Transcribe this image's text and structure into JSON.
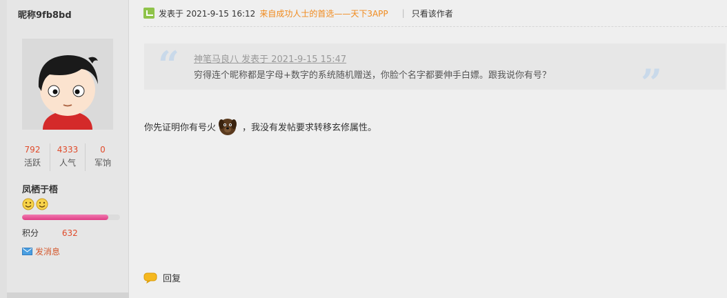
{
  "author": {
    "username": "昵称9fb8bd",
    "stats": [
      {
        "value": "792",
        "label": "活跃"
      },
      {
        "value": "4333",
        "label": "人气"
      },
      {
        "value": "0",
        "label": "军饷"
      }
    ],
    "group": "凤栖于梧",
    "points_label": "积分",
    "points_value": "632",
    "level_progress_percent": 88,
    "send_message": "发消息"
  },
  "post": {
    "posted_at": "发表于 2021-9-15 16:12",
    "promo": "来自成功人士的首选——天下3APP",
    "only_author": "只看该作者",
    "quote": {
      "header": "神笔马良八 发表于 2021-9-15 15:47",
      "text": "穷得连个昵称都是字母+数字的系统随机赠送，你脸个名字都要伸手白嫖。跟我说你有号？"
    },
    "content_before": "你先证明你有号火",
    "content_after": "，我没有发帖要求转移玄修属性。",
    "reply_label": "回复"
  },
  "colors": {
    "accent_red": "#e04a2a",
    "promo_orange": "#f08a1c",
    "progress_pink": "#e03e86"
  }
}
